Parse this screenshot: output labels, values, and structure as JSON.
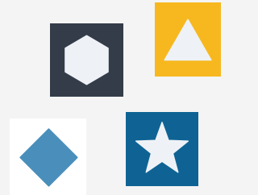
{
  "colors": {
    "canvas_bg": "#f4f4f4",
    "hexagon_tile_bg": "#343c49",
    "hexagon_fill": "#eef2f6",
    "triangle_tile_bg": "#f7b81f",
    "triangle_fill": "#eef2f6",
    "diamond_tile_bg": "#ffffff",
    "diamond_fill": "#4a8fbb",
    "star_tile_bg": "#0f6394",
    "star_fill": "#eef2f6"
  },
  "tiles": [
    {
      "icon": "hexagon-icon"
    },
    {
      "icon": "triangle-icon"
    },
    {
      "icon": "diamond-icon"
    },
    {
      "icon": "star-icon"
    }
  ]
}
